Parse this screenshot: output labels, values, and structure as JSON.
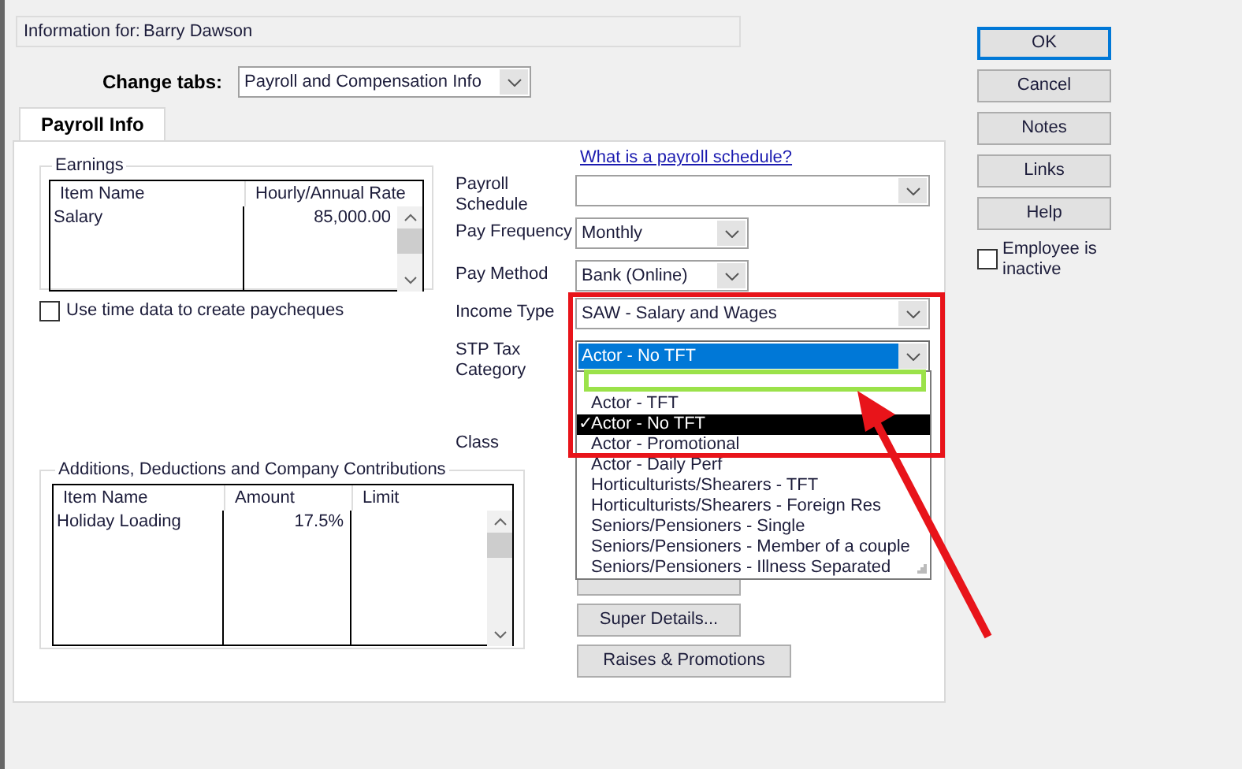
{
  "header": {
    "label": "Information for:",
    "name": "Barry Dawson"
  },
  "change_tabs": {
    "label": "Change tabs:",
    "value": "Payroll and Compensation Info"
  },
  "tabs": [
    {
      "label": "Payroll Info",
      "selected": true
    }
  ],
  "earnings": {
    "title": "Earnings",
    "columns": [
      "Item Name",
      "Hourly/Annual Rate"
    ],
    "rows": [
      [
        "Salary",
        "85,000.00"
      ]
    ]
  },
  "use_time_data": {
    "label": "Use time data to create paycheques",
    "checked": false
  },
  "schedule_link": "What is a payroll schedule?",
  "fields": [
    {
      "label": "Payroll Schedule",
      "focused": false
    },
    {
      "label": "Pay Frequency",
      "value": "Monthly",
      "focused": false
    },
    {
      "label": "Pay Method",
      "value": "Bank (Online)",
      "focused": false
    },
    {
      "label": "Income Type",
      "value": "SAW - Salary and Wages",
      "focused": false
    },
    {
      "label": "STP Tax Category",
      "value": "Actor - No TFT",
      "focused": true
    }
  ],
  "dropdown": {
    "check": "✓",
    "options": [
      {
        "label": "Actor - TFT",
        "selected": false
      },
      {
        "label": "Actor - No TFT",
        "selected": true
      },
      {
        "label": "Actor - Promotional",
        "selected": false
      },
      {
        "label": "Actor - Daily Perf",
        "selected": false
      },
      {
        "label": "Horticulturists/Shearers - TFT",
        "selected": false
      },
      {
        "label": "Horticulturists/Shearers - Foreign Res",
        "selected": false
      },
      {
        "label": "Seniors/Pensioners - Single",
        "selected": false
      },
      {
        "label": "Seniors/Pensioners - Member of a couple",
        "selected": false
      },
      {
        "label": "Seniors/Pensioners - Illness Separated",
        "selected": false
      }
    ]
  },
  "class_label": "Class",
  "additions": {
    "title": "Additions, Deductions and Company Contributions",
    "columns": [
      "Item Name",
      "Amount",
      "Limit"
    ],
    "rows": [
      [
        "Holiday Loading",
        "17.5%"
      ]
    ]
  },
  "panel_buttons": [
    "Super Details...",
    "Raises & Promotions"
  ],
  "dialog_buttons": [
    {
      "label": "OK",
      "default": true
    },
    {
      "label": "Cancel",
      "default": false
    },
    {
      "label": "Notes",
      "default": false
    },
    {
      "label": "Links",
      "default": false
    },
    {
      "label": "Help",
      "default": false
    }
  ],
  "inactive": {
    "label": "Employee is inactive",
    "checked": false
  }
}
